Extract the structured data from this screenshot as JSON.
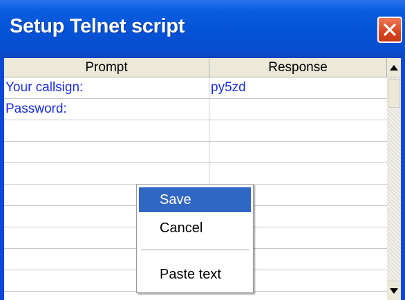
{
  "window": {
    "title": "Setup Telnet script",
    "close_icon": "close-icon"
  },
  "grid": {
    "columns": [
      "Prompt",
      "Response"
    ],
    "rows": [
      {
        "prompt": "Your callsign:",
        "response": "py5zd"
      },
      {
        "prompt": "Password:",
        "response": ""
      },
      {
        "prompt": "",
        "response": ""
      },
      {
        "prompt": "",
        "response": ""
      },
      {
        "prompt": "",
        "response": ""
      },
      {
        "prompt": "",
        "response": ""
      },
      {
        "prompt": "",
        "response": ""
      },
      {
        "prompt": "",
        "response": ""
      },
      {
        "prompt": "",
        "response": ""
      },
      {
        "prompt": "",
        "response": ""
      }
    ]
  },
  "context_menu": {
    "items": [
      "Save",
      "Cancel",
      "Paste text"
    ],
    "highlighted": "Save"
  },
  "colors": {
    "titlebar": "#0552d6",
    "cell_text": "#1a2ee0",
    "menu_highlight": "#3167c4",
    "close_button": "#d8441f"
  }
}
